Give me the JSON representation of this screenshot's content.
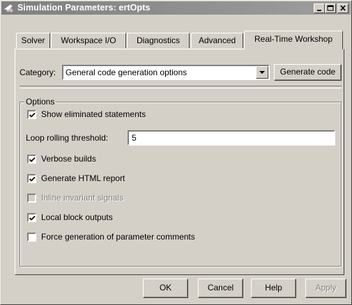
{
  "window": {
    "title": "Simulation Parameters: ertOpts"
  },
  "tabs": [
    {
      "label": "Solver"
    },
    {
      "label": "Workspace I/O"
    },
    {
      "label": "Diagnostics"
    },
    {
      "label": "Advanced"
    },
    {
      "label": "Real-Time Workshop",
      "active": true
    }
  ],
  "category": {
    "label": "Category:",
    "selected": "General code generation options"
  },
  "generate_code_label": "Generate code",
  "options": {
    "group_label": "Options",
    "show_eliminated": {
      "label": "Show eliminated statements",
      "checked": true,
      "enabled": true
    },
    "loop_rolling": {
      "label": "Loop rolling threshold:",
      "value": "5"
    },
    "verbose_builds": {
      "label": "Verbose builds",
      "checked": true,
      "enabled": true
    },
    "html_report": {
      "label": "Generate HTML report",
      "checked": true,
      "enabled": true
    },
    "inline_invariant": {
      "label": "Inline invariant signals",
      "checked": false,
      "enabled": false
    },
    "local_block_outputs": {
      "label": "Local block outputs",
      "checked": true,
      "enabled": true
    },
    "param_comments": {
      "label": "Force generation of parameter comments",
      "checked": false,
      "enabled": true
    }
  },
  "buttons": {
    "ok": "OK",
    "cancel": "Cancel",
    "help": "Help",
    "apply": "Apply"
  },
  "icons": {
    "app": "simulink-app-icon",
    "minimize": "minimize-icon",
    "maximize": "maximize-icon",
    "close": "close-icon",
    "dropdown": "chevron-down-icon",
    "check": "checkmark-icon"
  },
  "colors": {
    "face": "#d4d0c8",
    "title_inactive": "#8c8c8c",
    "disabled_text": "#808080"
  }
}
